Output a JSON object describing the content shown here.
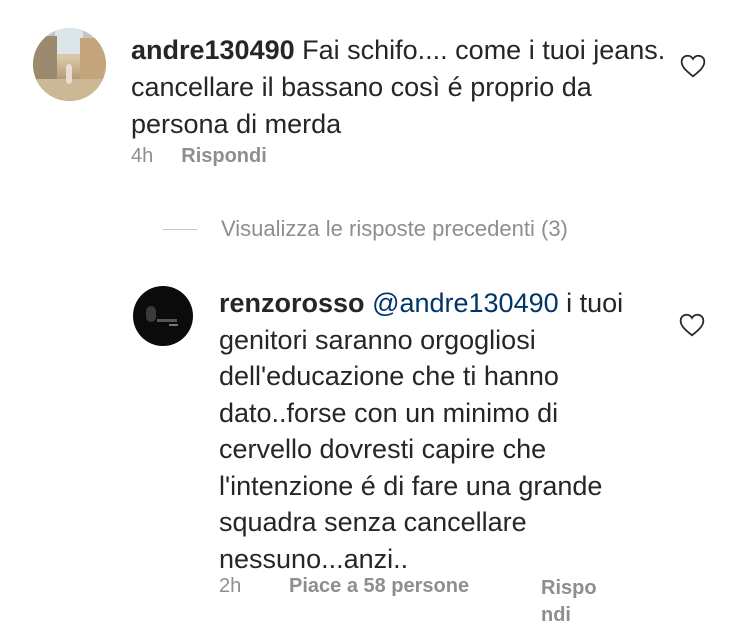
{
  "comments": [
    {
      "username": "andre130490",
      "text": " Fai schifo.... come i tuoi jeans.  cancellare il bassano così é proprio da persona di merda",
      "time": "4h",
      "reply_label": "Rispondi"
    }
  ],
  "view_previous_replies": "Visualizza le risposte precedenti (3)",
  "reply": {
    "username": "renzorosso",
    "mention": "@andre130490",
    "text": " i tuoi genitori saranno orgogliosi dell'educazione che ti hanno dato..forse con un minimo di cervello dovresti capire che l'intenzione é di fare una grande squadra senza cancellare nessuno...anzi..",
    "time": "2h",
    "likes": "Piace a 58 persone",
    "reply_label_line1": "Rispo",
    "reply_label_line2": "ndi"
  },
  "icons": {
    "like": "heart-outline-icon"
  },
  "colors": {
    "text": "#262626",
    "meta": "#8e8e8e",
    "mention": "#003569"
  }
}
